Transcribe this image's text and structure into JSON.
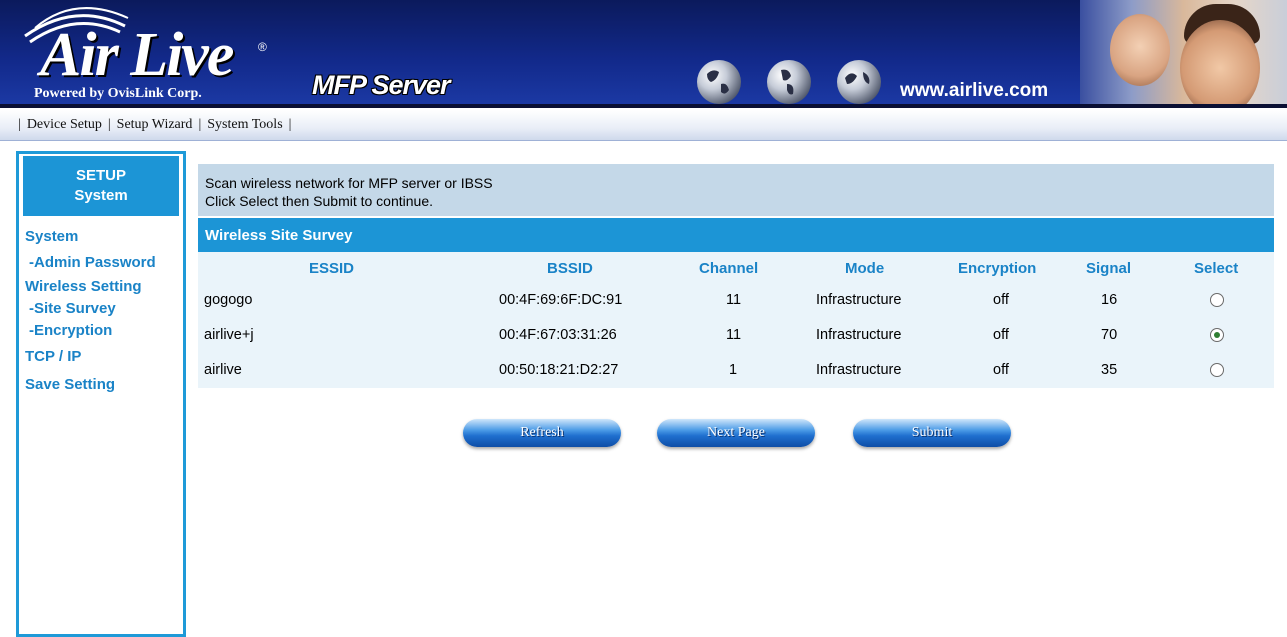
{
  "brand": {
    "logo_text": "Air Live",
    "logo_registered": "®",
    "powered_by": "Powered by OvisLink Corp.",
    "product": "MFP Server",
    "url": "www.airlive.com"
  },
  "topmenu": {
    "items": [
      "Device Setup",
      "Setup Wizard",
      "System Tools"
    ]
  },
  "sidebar": {
    "header_line1": "SETUP",
    "header_line2": "System",
    "items": [
      {
        "label": "System"
      },
      {
        "label": "-Admin Password"
      },
      {
        "label": "Wireless Setting"
      },
      {
        "label": "-Site Survey"
      },
      {
        "label": "-Encryption"
      },
      {
        "label": "TCP / IP"
      },
      {
        "label": "Save Setting"
      }
    ]
  },
  "info": {
    "line1": "Scan wireless network for MFP server or IBSS",
    "line2": "Click Select then Submit to continue."
  },
  "survey": {
    "title": "Wireless Site Survey",
    "columns": [
      "ESSID",
      "BSSID",
      "Channel",
      "Mode",
      "Encryption",
      "Signal",
      "Select"
    ],
    "rows": [
      {
        "essid": "gogogo",
        "bssid": "00:4F:69:6F:DC:91",
        "channel": "11",
        "mode": "Infrastructure",
        "encryption": "off",
        "signal": "16",
        "selected": false
      },
      {
        "essid": "airlive+j",
        "bssid": "00:4F:67:03:31:26",
        "channel": "11",
        "mode": "Infrastructure",
        "encryption": "off",
        "signal": "70",
        "selected": true
      },
      {
        "essid": "airlive",
        "bssid": "00:50:18:21:D2:27",
        "channel": "1",
        "mode": "Infrastructure",
        "encryption": "off",
        "signal": "35",
        "selected": false
      }
    ]
  },
  "buttons": {
    "refresh": "Refresh",
    "next_page": "Next Page",
    "submit": "Submit"
  },
  "colors": {
    "accent": "#1c95d6",
    "link": "#1a83c7",
    "info_bg": "#c4d8e8",
    "table_bg": "#eaf4fa"
  }
}
